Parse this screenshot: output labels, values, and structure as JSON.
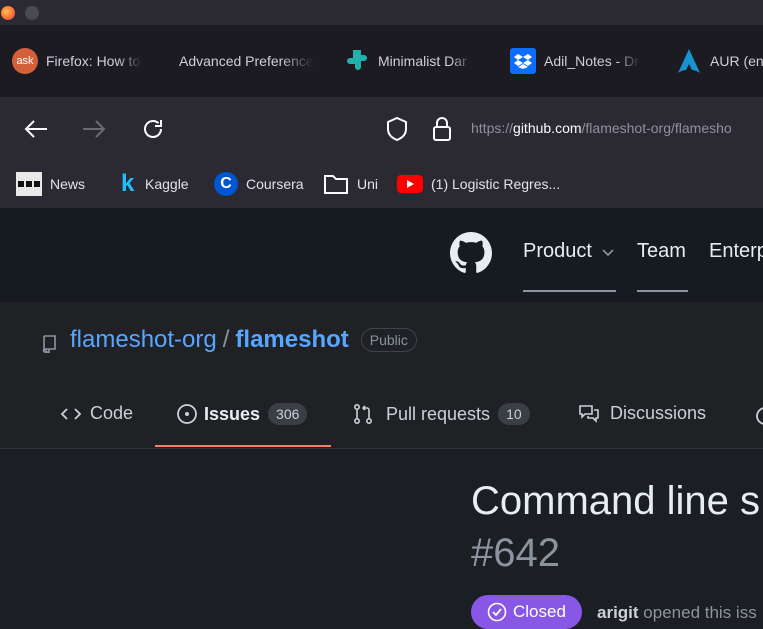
{
  "tabs": [
    {
      "label": "Firefox: How to",
      "icon": "ask-icon"
    },
    {
      "label": "Advanced Preference",
      "icon": "none"
    },
    {
      "label": "Minimalist Dar",
      "icon": "puzzle-icon"
    },
    {
      "label": "Adil_Notes - Dr",
      "icon": "dropbox-icon"
    },
    {
      "label": "AUR (en",
      "icon": "arch-icon"
    }
  ],
  "url": {
    "prefix": "https://",
    "domain": "github.com",
    "path": "/flameshot-org/flamesho"
  },
  "bookmarks": [
    {
      "label": "News",
      "icon": "news-icon"
    },
    {
      "label": "Kaggle",
      "icon": "kaggle-icon"
    },
    {
      "label": "Coursera",
      "icon": "coursera-icon"
    },
    {
      "label": "Uni",
      "icon": "folder-icon"
    },
    {
      "label": "(1) Logistic Regres...",
      "icon": "youtube-icon"
    }
  ],
  "github": {
    "nav": {
      "product": "Product",
      "team": "Team",
      "enterprise": "Enterp"
    },
    "repo": {
      "owner": "flameshot-org",
      "sep": "/",
      "name": "flameshot",
      "visibility": "Public"
    },
    "tabs": {
      "code": "Code",
      "issues": "Issues",
      "issues_count": "306",
      "pulls": "Pull requests",
      "pulls_count": "10",
      "discussions": "Discussions"
    },
    "issue": {
      "title": "Command line s",
      "number": "#642",
      "state": "Closed",
      "author": "arigit",
      "action": "opened this iss"
    }
  },
  "colors": {
    "accent_link": "#58a6ff",
    "closed_badge": "#8957e5",
    "tab_underline": "#f78166"
  }
}
